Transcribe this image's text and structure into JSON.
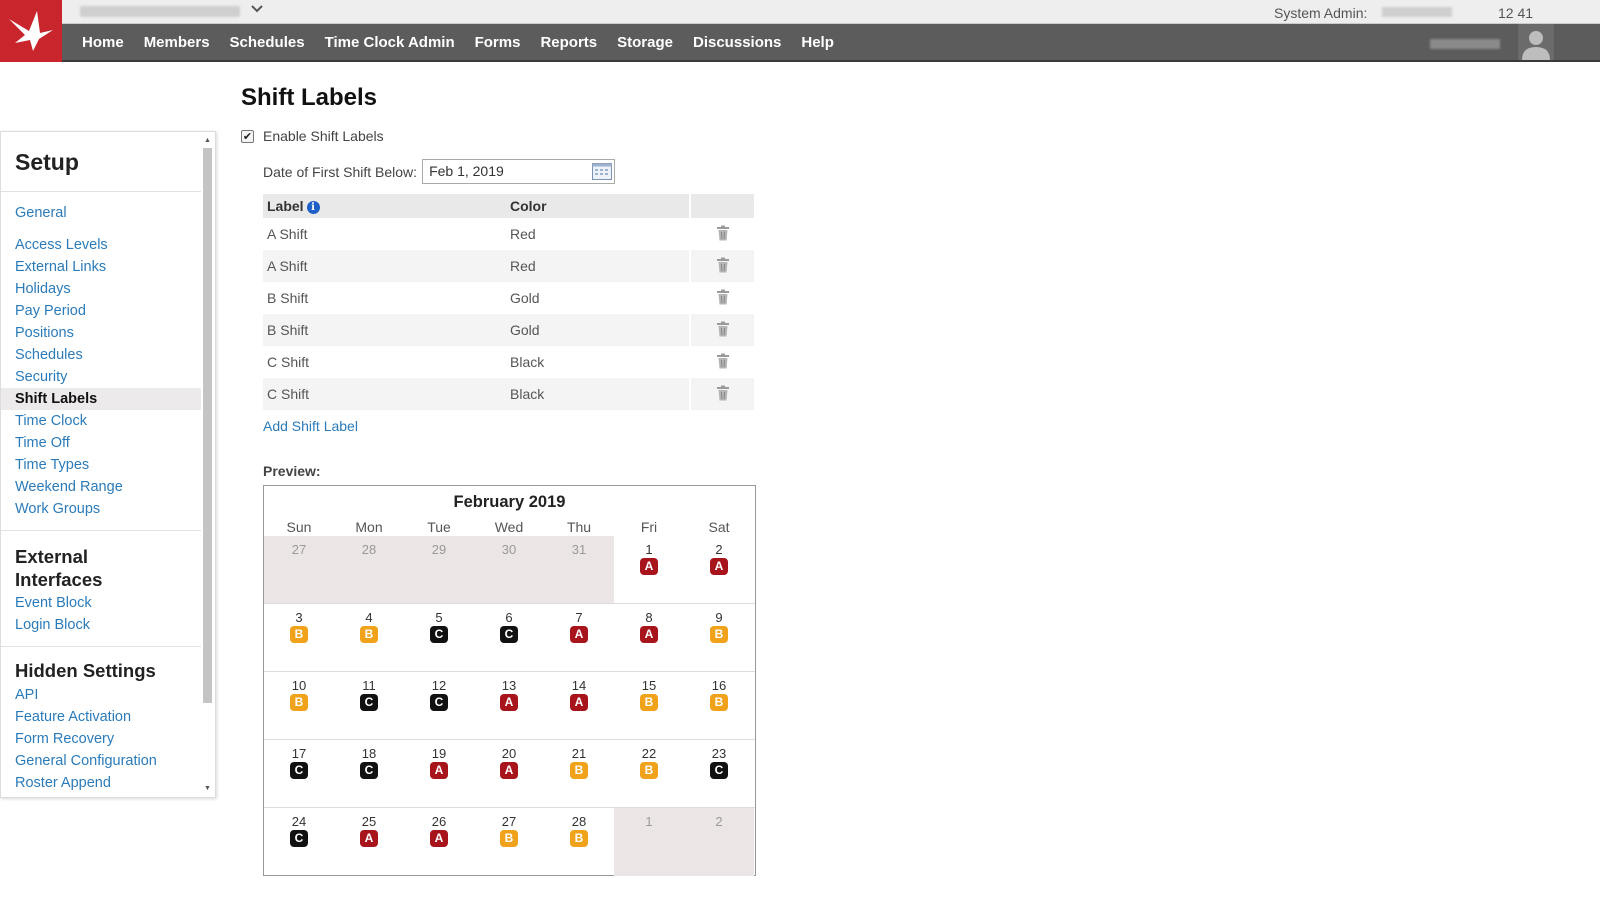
{
  "app": {
    "admin_label": "System Admin:",
    "time": "12 41"
  },
  "nav": [
    "Home",
    "Members",
    "Schedules",
    "Time Clock Admin",
    "Forms",
    "Reports",
    "Storage",
    "Discussions",
    "Help"
  ],
  "sidebar": {
    "sections": [
      {
        "title": "Setup",
        "items": [
          "General",
          "Access Levels",
          "External Links",
          "Holidays",
          "Pay Period",
          "Positions",
          "Schedules",
          "Security",
          "Shift Labels",
          "Time Clock",
          "Time Off",
          "Time Types",
          "Weekend Range",
          "Work Groups"
        ]
      },
      {
        "title": "External Interfaces",
        "items": [
          "Event Block",
          "Login Block"
        ]
      },
      {
        "title": "Hidden Settings",
        "items": [
          "API",
          "Feature Activation",
          "Form Recovery",
          "General Configuration",
          "Roster Append"
        ]
      }
    ],
    "active_item": "Shift Labels"
  },
  "page": {
    "title": "Shift Labels",
    "enable_label": "Enable Shift Labels",
    "enable_checked": true,
    "date_label": "Date of First Shift Below:",
    "date_value": "Feb 1, 2019",
    "table_headers": {
      "label": "Label",
      "color": "Color"
    },
    "shift_labels": [
      {
        "label": "A Shift",
        "color": "Red"
      },
      {
        "label": "A Shift",
        "color": "Red"
      },
      {
        "label": "B Shift",
        "color": "Gold"
      },
      {
        "label": "B Shift",
        "color": "Gold"
      },
      {
        "label": "C Shift",
        "color": "Black"
      },
      {
        "label": "C Shift",
        "color": "Black"
      }
    ],
    "add_label": "Add Shift Label",
    "preview_label": "Preview:"
  },
  "calendar": {
    "title": "February 2019",
    "days_of_week": [
      "Sun",
      "Mon",
      "Tue",
      "Wed",
      "Thu",
      "Fri",
      "Sat"
    ],
    "badge_colors": {
      "A": "#a8141b",
      "B": "#f0a21a",
      "C": "#111111"
    },
    "weeks": [
      [
        {
          "d": "27",
          "out": true
        },
        {
          "d": "28",
          "out": true
        },
        {
          "d": "29",
          "out": true
        },
        {
          "d": "30",
          "out": true
        },
        {
          "d": "31",
          "out": true
        },
        {
          "d": "1",
          "s": "A"
        },
        {
          "d": "2",
          "s": "A"
        }
      ],
      [
        {
          "d": "3",
          "s": "B"
        },
        {
          "d": "4",
          "s": "B"
        },
        {
          "d": "5",
          "s": "C"
        },
        {
          "d": "6",
          "s": "C"
        },
        {
          "d": "7",
          "s": "A"
        },
        {
          "d": "8",
          "s": "A"
        },
        {
          "d": "9",
          "s": "B"
        }
      ],
      [
        {
          "d": "10",
          "s": "B"
        },
        {
          "d": "11",
          "s": "C"
        },
        {
          "d": "12",
          "s": "C"
        },
        {
          "d": "13",
          "s": "A"
        },
        {
          "d": "14",
          "s": "A"
        },
        {
          "d": "15",
          "s": "B"
        },
        {
          "d": "16",
          "s": "B"
        }
      ],
      [
        {
          "d": "17",
          "s": "C"
        },
        {
          "d": "18",
          "s": "C"
        },
        {
          "d": "19",
          "s": "A"
        },
        {
          "d": "20",
          "s": "A"
        },
        {
          "d": "21",
          "s": "B"
        },
        {
          "d": "22",
          "s": "B"
        },
        {
          "d": "23",
          "s": "C"
        }
      ],
      [
        {
          "d": "24",
          "s": "C"
        },
        {
          "d": "25",
          "s": "A"
        },
        {
          "d": "26",
          "s": "A"
        },
        {
          "d": "27",
          "s": "B"
        },
        {
          "d": "28",
          "s": "B"
        },
        {
          "d": "1",
          "out": true
        },
        {
          "d": "2",
          "out": true
        }
      ]
    ]
  },
  "colors": {
    "brand": "#c8262c",
    "nav_bg": "#5c5c5c",
    "link": "#2b7bb9"
  }
}
